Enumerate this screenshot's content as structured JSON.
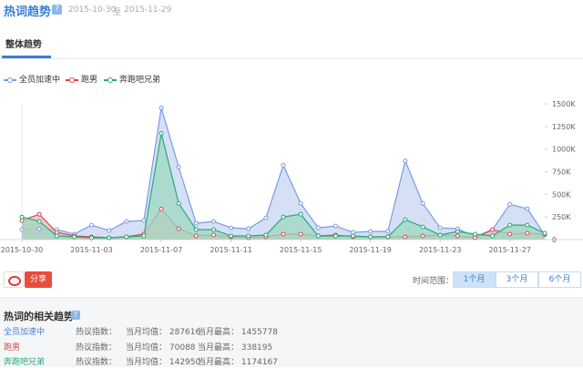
{
  "header": {
    "title": "热词趋势",
    "help": "?",
    "date_start": "2015-10-30",
    "date_sep": "至",
    "date_end": "2015-11-29"
  },
  "tabs": [
    {
      "label": "整体趋势"
    }
  ],
  "share": {
    "button_label": "分享"
  },
  "time_range": {
    "label": "时间范围：",
    "options": [
      "1个月",
      "3个月",
      "6个月"
    ],
    "selected": "1个月"
  },
  "related": {
    "title": "热词的相关趋势",
    "help": "?",
    "rows": [
      {
        "name": "全员加速中",
        "col1": "热议指数：",
        "col2": "当月均值： 287616",
        "col3": "当月最高： 1455778",
        "color": "#4a7fd4"
      },
      {
        "name": "跑男",
        "col1": "热议指数：",
        "col2": "当月均值： 70088",
        "col3": "当月最高： 338195",
        "color": "#e0454d"
      },
      {
        "name": "奔跑吧兄弟",
        "col1": "热议指数：",
        "col2": "当月均值： 142950",
        "col3": "当月最高： 1174167",
        "color": "#2aa87a"
      }
    ]
  },
  "chart_data": {
    "type": "area",
    "x": [
      "2015-10-30",
      "2015-10-31",
      "2015-11-01",
      "2015-11-02",
      "2015-11-03",
      "2015-11-04",
      "2015-11-05",
      "2015-11-06",
      "2015-11-07",
      "2015-11-08",
      "2015-11-09",
      "2015-11-10",
      "2015-11-11",
      "2015-11-12",
      "2015-11-13",
      "2015-11-14",
      "2015-11-15",
      "2015-11-16",
      "2015-11-17",
      "2015-11-18",
      "2015-11-19",
      "2015-11-20",
      "2015-11-21",
      "2015-11-22",
      "2015-11-23",
      "2015-11-24",
      "2015-11-25",
      "2015-11-26",
      "2015-11-27",
      "2015-11-28",
      "2015-11-29"
    ],
    "x_tick_labels": [
      "2015-10-30",
      "2015-11-03",
      "2015-11-07",
      "2015-11-11",
      "2015-11-15",
      "2015-11-19",
      "2015-11-23",
      "2015-11-27"
    ],
    "y_ticks": [
      0,
      250000,
      500000,
      750000,
      1000000,
      1250000,
      1500000
    ],
    "y_tick_labels": [
      "0",
      "250K",
      "500K",
      "750K",
      "1000K",
      "1250K",
      "1500K"
    ],
    "ylim": [
      0,
      1500000
    ],
    "legend_position": "top-left",
    "grid": false,
    "series": [
      {
        "name": "全员加速中",
        "color": "#7b9be0",
        "fill": "#c7d6f4",
        "values": [
          110000,
          120000,
          110000,
          60000,
          160000,
          100000,
          200000,
          210000,
          1455778,
          800000,
          180000,
          200000,
          130000,
          120000,
          240000,
          820000,
          400000,
          130000,
          150000,
          80000,
          90000,
          90000,
          870000,
          400000,
          130000,
          120000,
          30000,
          110000,
          390000,
          340000,
          50000
        ]
      },
      {
        "name": "跑男",
        "color": "#e0454d",
        "fill": "#e9b9bd",
        "values": [
          210000,
          280000,
          80000,
          40000,
          30000,
          20000,
          30000,
          60000,
          338195,
          120000,
          40000,
          50000,
          30000,
          20000,
          30000,
          60000,
          60000,
          40000,
          50000,
          30000,
          30000,
          30000,
          30000,
          40000,
          50000,
          40000,
          20000,
          110000,
          60000,
          70000,
          60000
        ]
      },
      {
        "name": "奔跑吧兄弟",
        "color": "#2aa87a",
        "fill": "#9dd8c2",
        "values": [
          250000,
          200000,
          40000,
          30000,
          20000,
          20000,
          30000,
          40000,
          1174167,
          400000,
          110000,
          110000,
          40000,
          40000,
          50000,
          250000,
          280000,
          40000,
          40000,
          40000,
          30000,
          30000,
          220000,
          140000,
          50000,
          90000,
          60000,
          40000,
          160000,
          160000,
          70000
        ]
      }
    ]
  }
}
